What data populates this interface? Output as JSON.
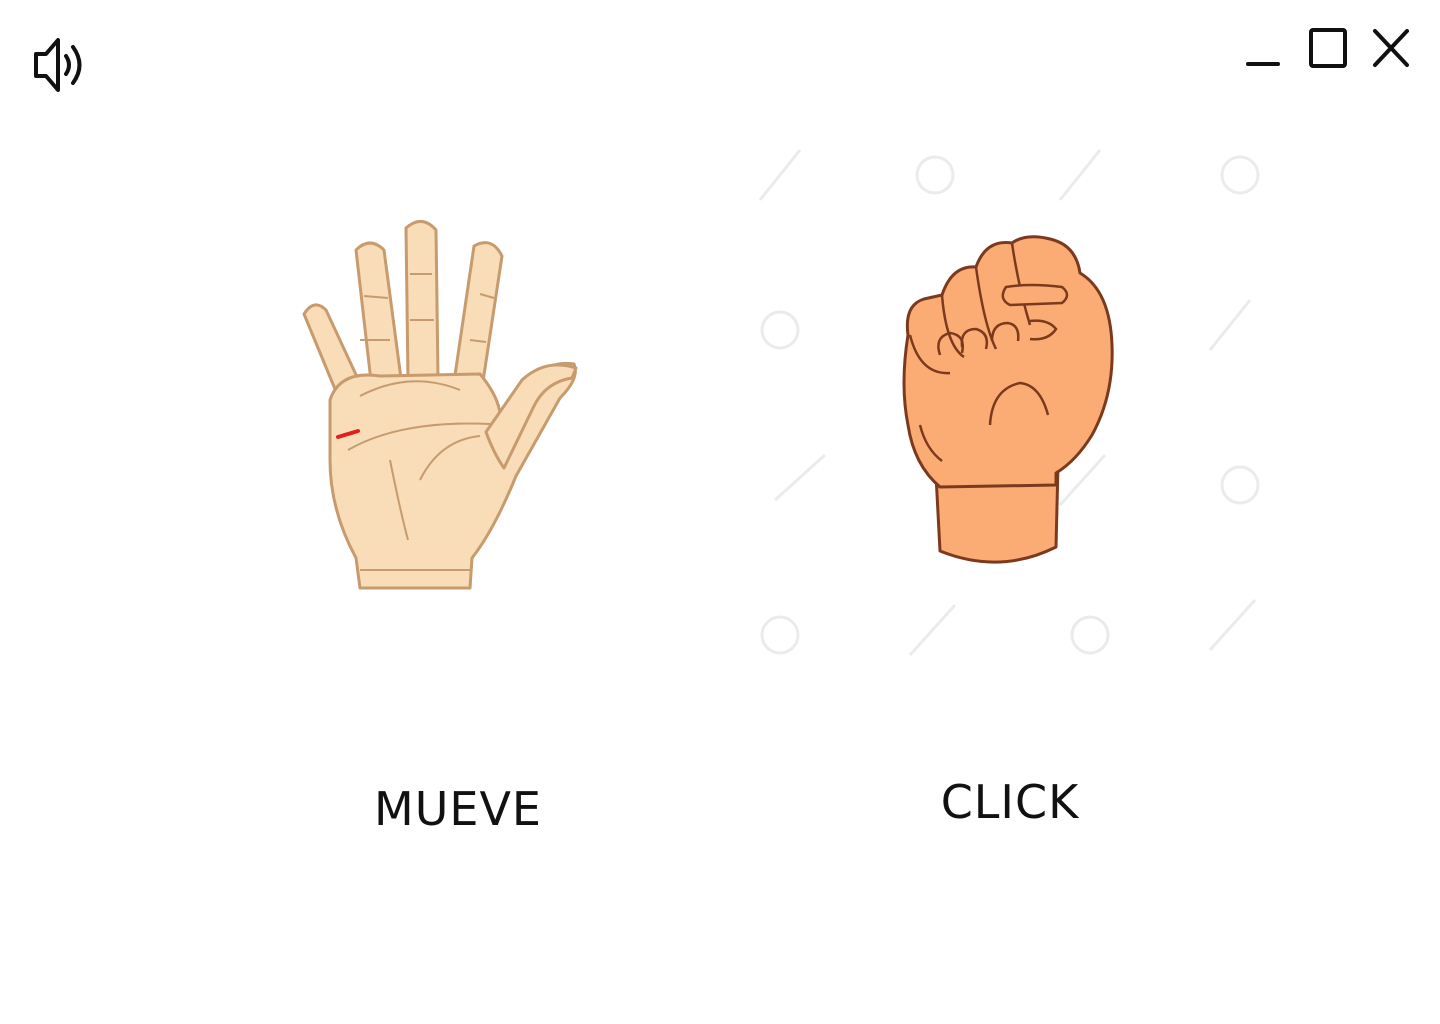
{
  "icons": {
    "sound": "speaker-volume-icon",
    "minimize": "minimize-icon",
    "maximize": "maximize-icon",
    "close": "close-icon"
  },
  "gestures": [
    {
      "id": "open-hand",
      "image": "open-hand-icon",
      "label": "MUEVE"
    },
    {
      "id": "fist",
      "image": "closed-fist-icon",
      "label": "CLICK"
    }
  ],
  "colors": {
    "background": "#ffffff",
    "icon_stroke": "#111111",
    "open_hand_skin": "#f9dcb8",
    "open_hand_outline": "#c79b6d",
    "fist_skin": "#fbac74",
    "fist_outline": "#7b3a1e",
    "accent_mark": "#e02020"
  }
}
